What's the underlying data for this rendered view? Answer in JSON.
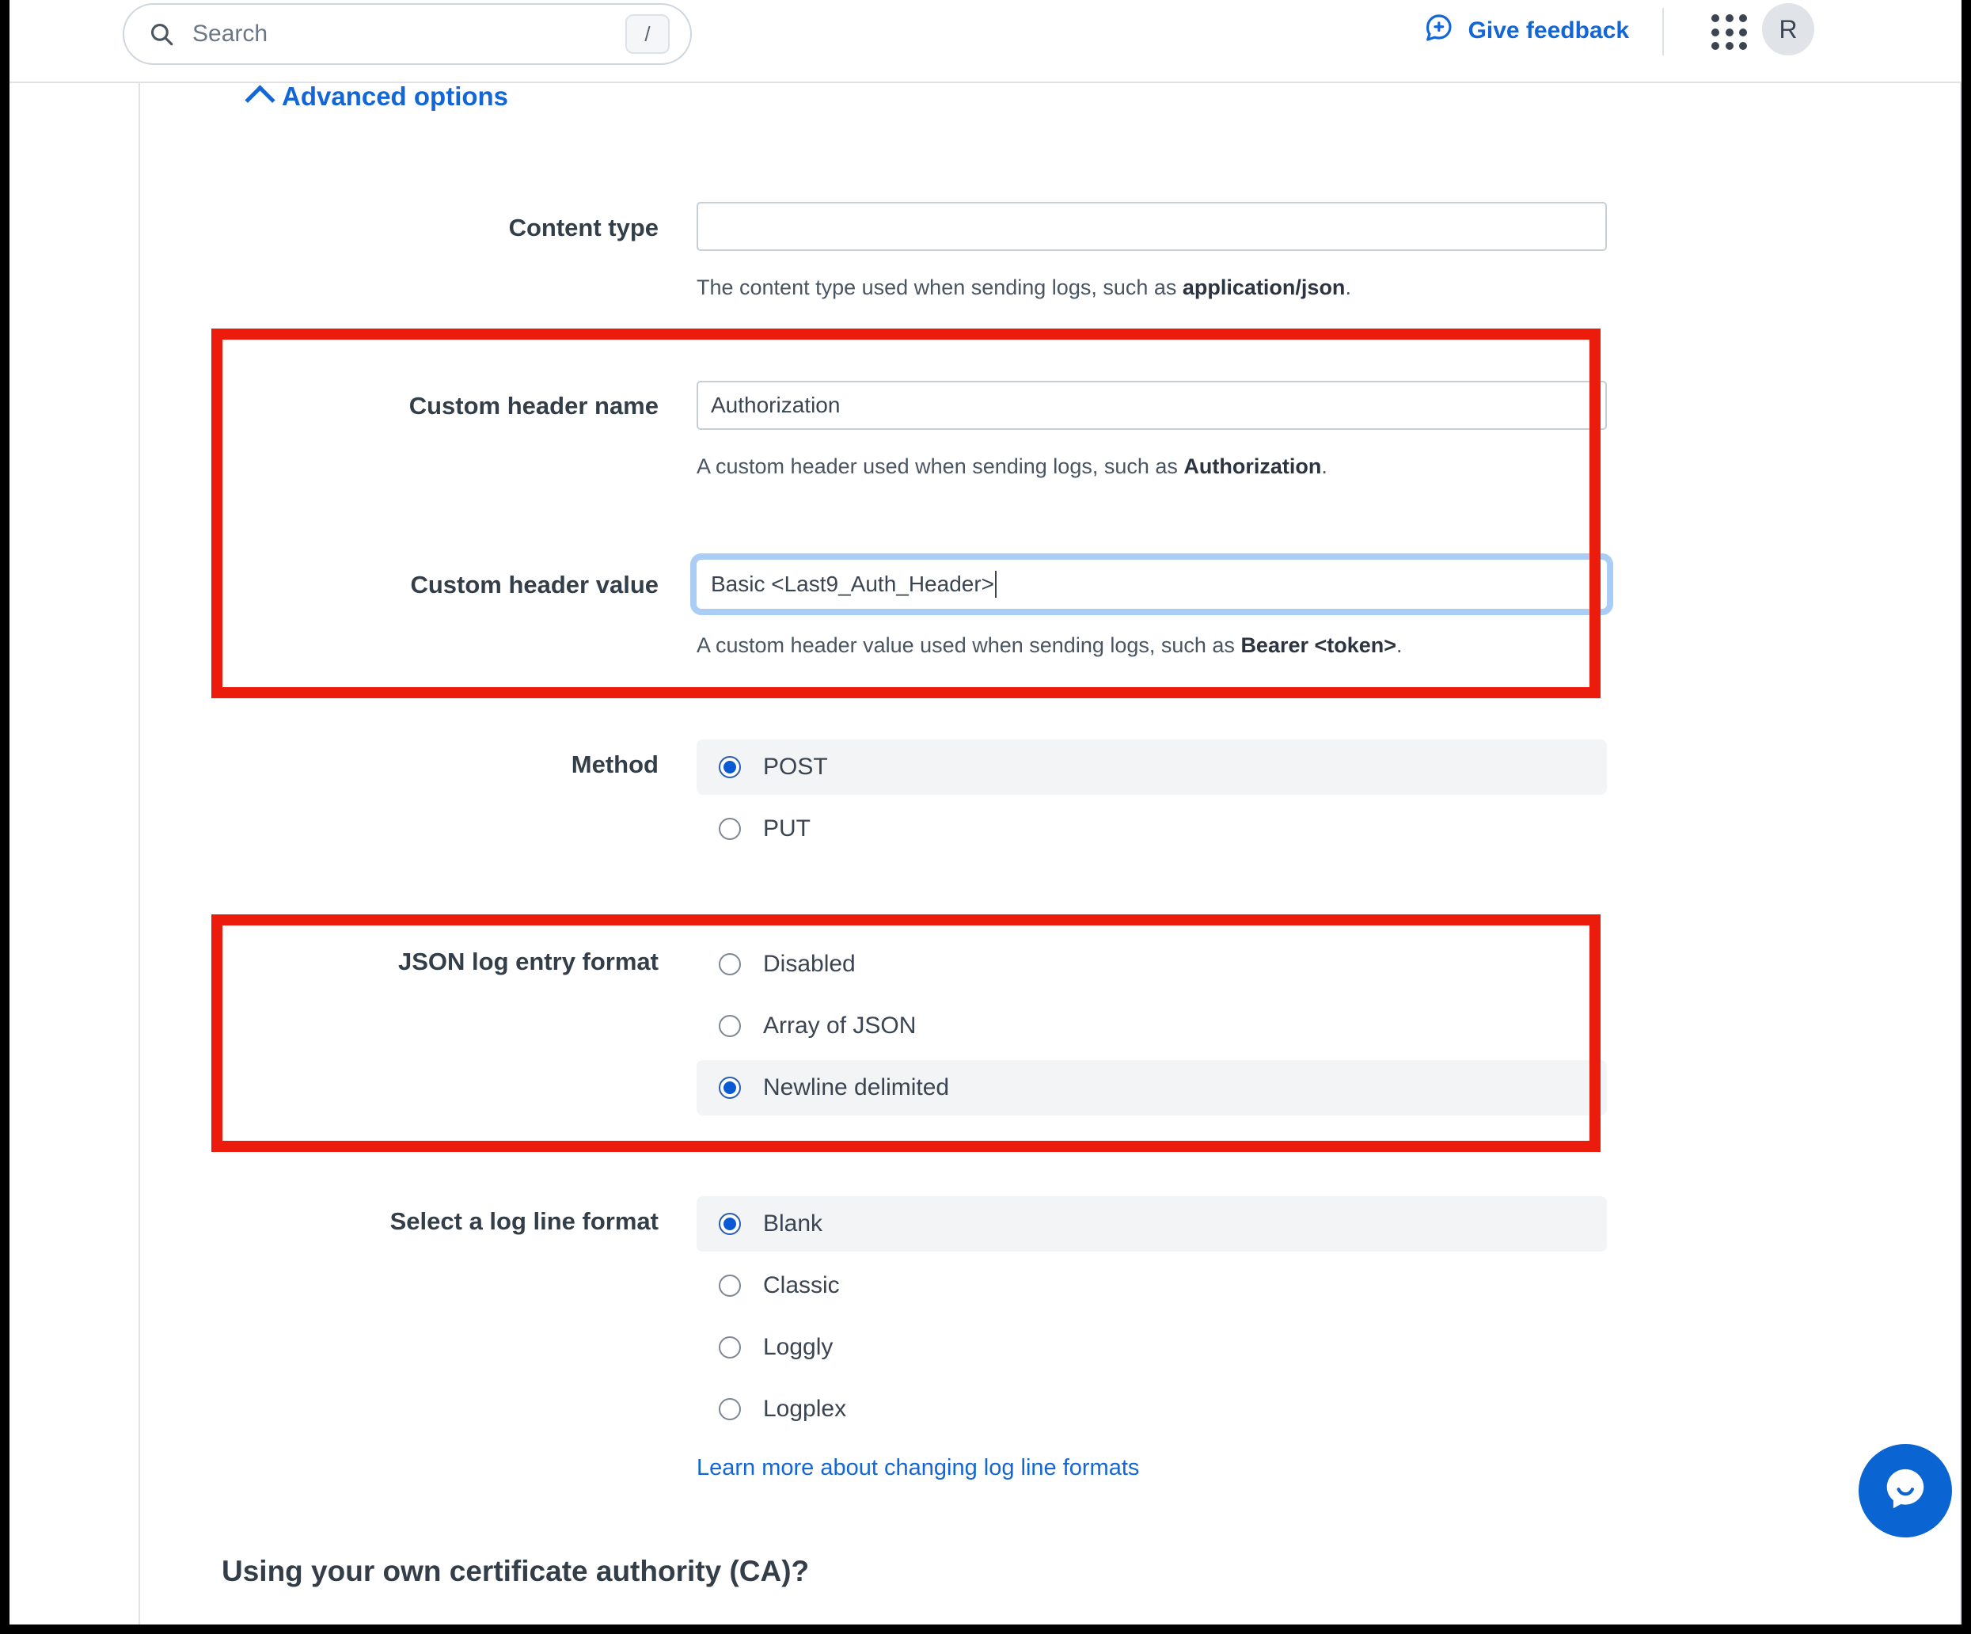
{
  "topbar": {
    "search_placeholder": "Search",
    "search_shortcut": "/",
    "feedback_label": "Give feedback",
    "avatar_initial": "R"
  },
  "advanced_options": {
    "label": "Advanced options"
  },
  "form": {
    "content_type": {
      "label": "Content type",
      "value": "",
      "help_prefix": "The content type used when sending logs, such as ",
      "help_strong": "application/json",
      "help_suffix": "."
    },
    "custom_header_name": {
      "label": "Custom header name",
      "value": "Authorization",
      "help_prefix": "A custom header used when sending logs, such as ",
      "help_strong": "Authorization",
      "help_suffix": "."
    },
    "custom_header_value": {
      "label": "Custom header value",
      "value": "Basic <Last9_Auth_Header>",
      "help_prefix": "A custom header value used when sending logs, such as ",
      "help_strong": "Bearer <token>",
      "help_suffix": "."
    },
    "method": {
      "label": "Method",
      "options": [
        {
          "label": "POST",
          "selected": true
        },
        {
          "label": "PUT",
          "selected": false
        }
      ]
    },
    "json_log_entry_format": {
      "label": "JSON log entry format",
      "options": [
        {
          "label": "Disabled",
          "selected": false
        },
        {
          "label": "Array of JSON",
          "selected": false
        },
        {
          "label": "Newline delimited",
          "selected": true
        }
      ]
    },
    "log_line_format": {
      "label": "Select a log line format",
      "options": [
        {
          "label": "Blank",
          "selected": true
        },
        {
          "label": "Classic",
          "selected": false
        },
        {
          "label": "Loggly",
          "selected": false
        },
        {
          "label": "Logplex",
          "selected": false
        }
      ],
      "learn_more_link": "Learn more about changing log line formats"
    }
  },
  "ca_section": {
    "heading": "Using your own certificate authority (CA)?"
  },
  "colors": {
    "link_blue": "#1366d6",
    "annotation_red": "#ec1c0c",
    "label_dark": "#333e48",
    "selected_row_bg": "#f2f4f6",
    "input_border": "#c6ced6",
    "focus_ring": "#a9cdf4",
    "chat_blue": "#0a64d2"
  }
}
